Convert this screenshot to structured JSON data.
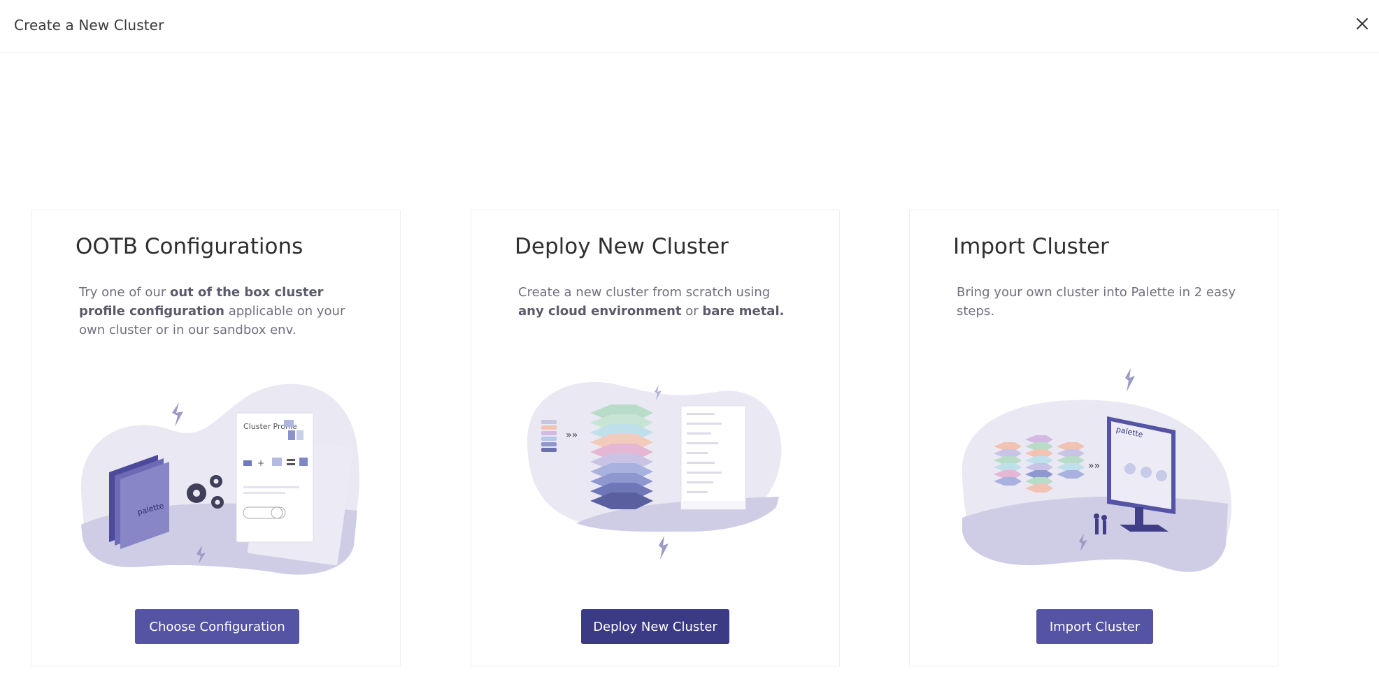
{
  "dialog": {
    "title": "Create a New Cluster",
    "close_icon": "close-icon"
  },
  "cards": [
    {
      "title": "OOTB Configurations",
      "desc_parts": [
        "Try one of our ",
        "out of the box cluster profile configuration",
        " applicable on your own cluster or in our sandbox env."
      ],
      "illustration": {
        "icon": "cluster-profile-illustration",
        "folder_label": "palette",
        "profile_label": "Cluster Profile"
      },
      "button_label": "Choose Configuration"
    },
    {
      "title": "Deploy New Cluster",
      "desc_parts": [
        "Create a new cluster from scratch using ",
        "any cloud environment",
        " or ",
        "bare metal."
      ],
      "illustration": {
        "icon": "deploy-stack-illustration"
      },
      "button_label": "Deploy New Cluster"
    },
    {
      "title": "Import Cluster",
      "desc_parts": [
        "Bring your own cluster into Palette in 2 easy steps."
      ],
      "illustration": {
        "icon": "import-monitor-illustration",
        "monitor_label": "palette"
      },
      "button_label": "Import Cluster"
    }
  ],
  "colors": {
    "button": "#5553a3",
    "button_hover": "#3b3a85",
    "blob": "#e7e6f1",
    "accent": "#8a89c4"
  }
}
